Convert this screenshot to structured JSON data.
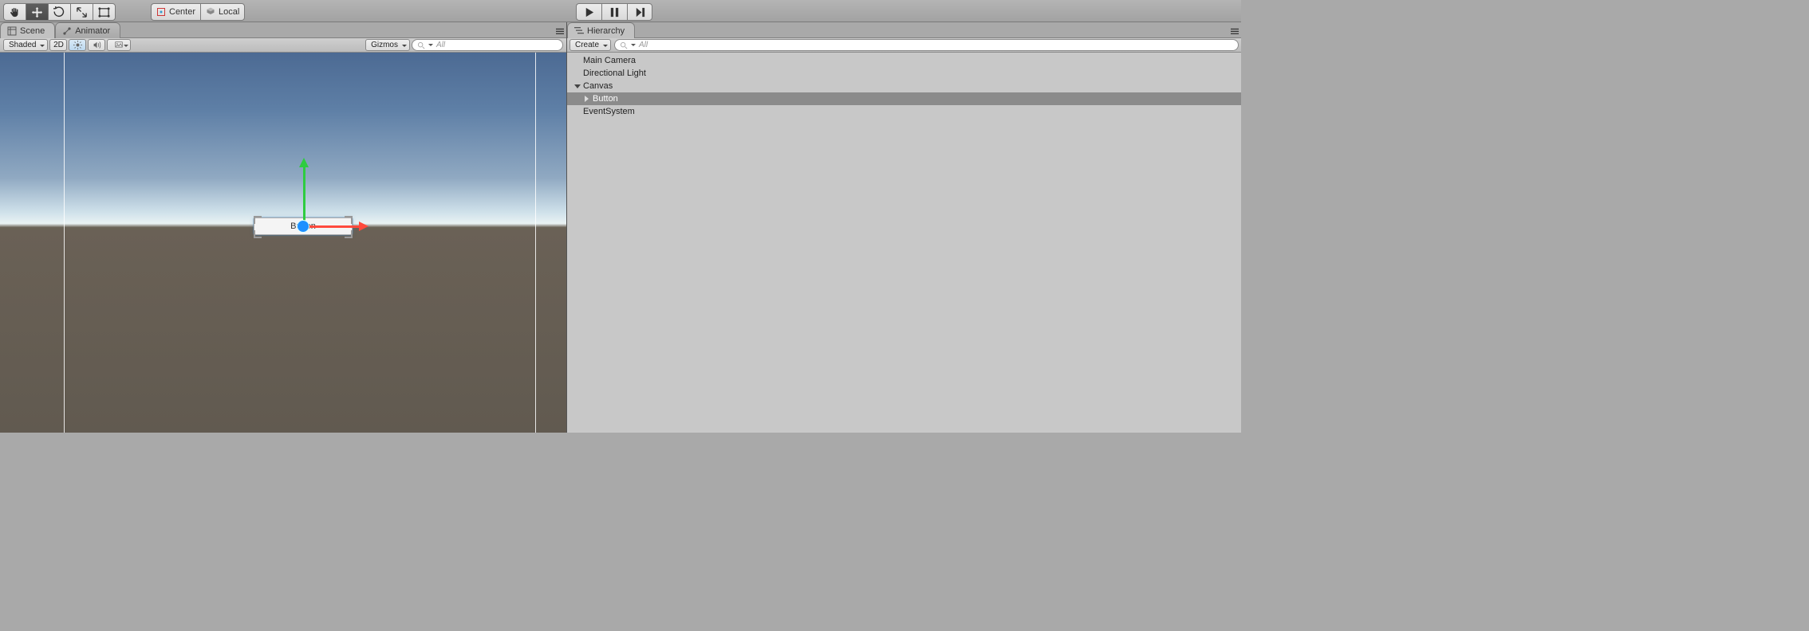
{
  "toolbar": {
    "tools": [
      "hand",
      "move",
      "rotate",
      "scale",
      "rect"
    ],
    "active_tool_index": 1,
    "pivot_mode": "Center",
    "pivot_space": "Local"
  },
  "panels": {
    "left_tabs": [
      {
        "label": "Scene",
        "icon": "scene"
      },
      {
        "label": "Animator",
        "icon": "animator"
      }
    ],
    "left_active": 0,
    "right_tabs": [
      {
        "label": "Hierarchy",
        "icon": "hierarchy"
      }
    ]
  },
  "scene": {
    "shading": "Shaded",
    "toggle_2d": "2D",
    "gizmos_label": "Gizmos",
    "search_placeholder": "All",
    "canvas_button_text": "Button"
  },
  "hierarchy": {
    "create_label": "Create",
    "search_placeholder": "All",
    "items": [
      {
        "label": "Main Camera",
        "depth": 1,
        "expander": "",
        "selected": false
      },
      {
        "label": "Directional Light",
        "depth": 1,
        "expander": "",
        "selected": false
      },
      {
        "label": "Canvas",
        "depth": 1,
        "expander": "down",
        "selected": false
      },
      {
        "label": "Button",
        "depth": 2,
        "expander": "right",
        "selected": true
      },
      {
        "label": "EventSystem",
        "depth": 1,
        "expander": "",
        "selected": false
      }
    ]
  }
}
